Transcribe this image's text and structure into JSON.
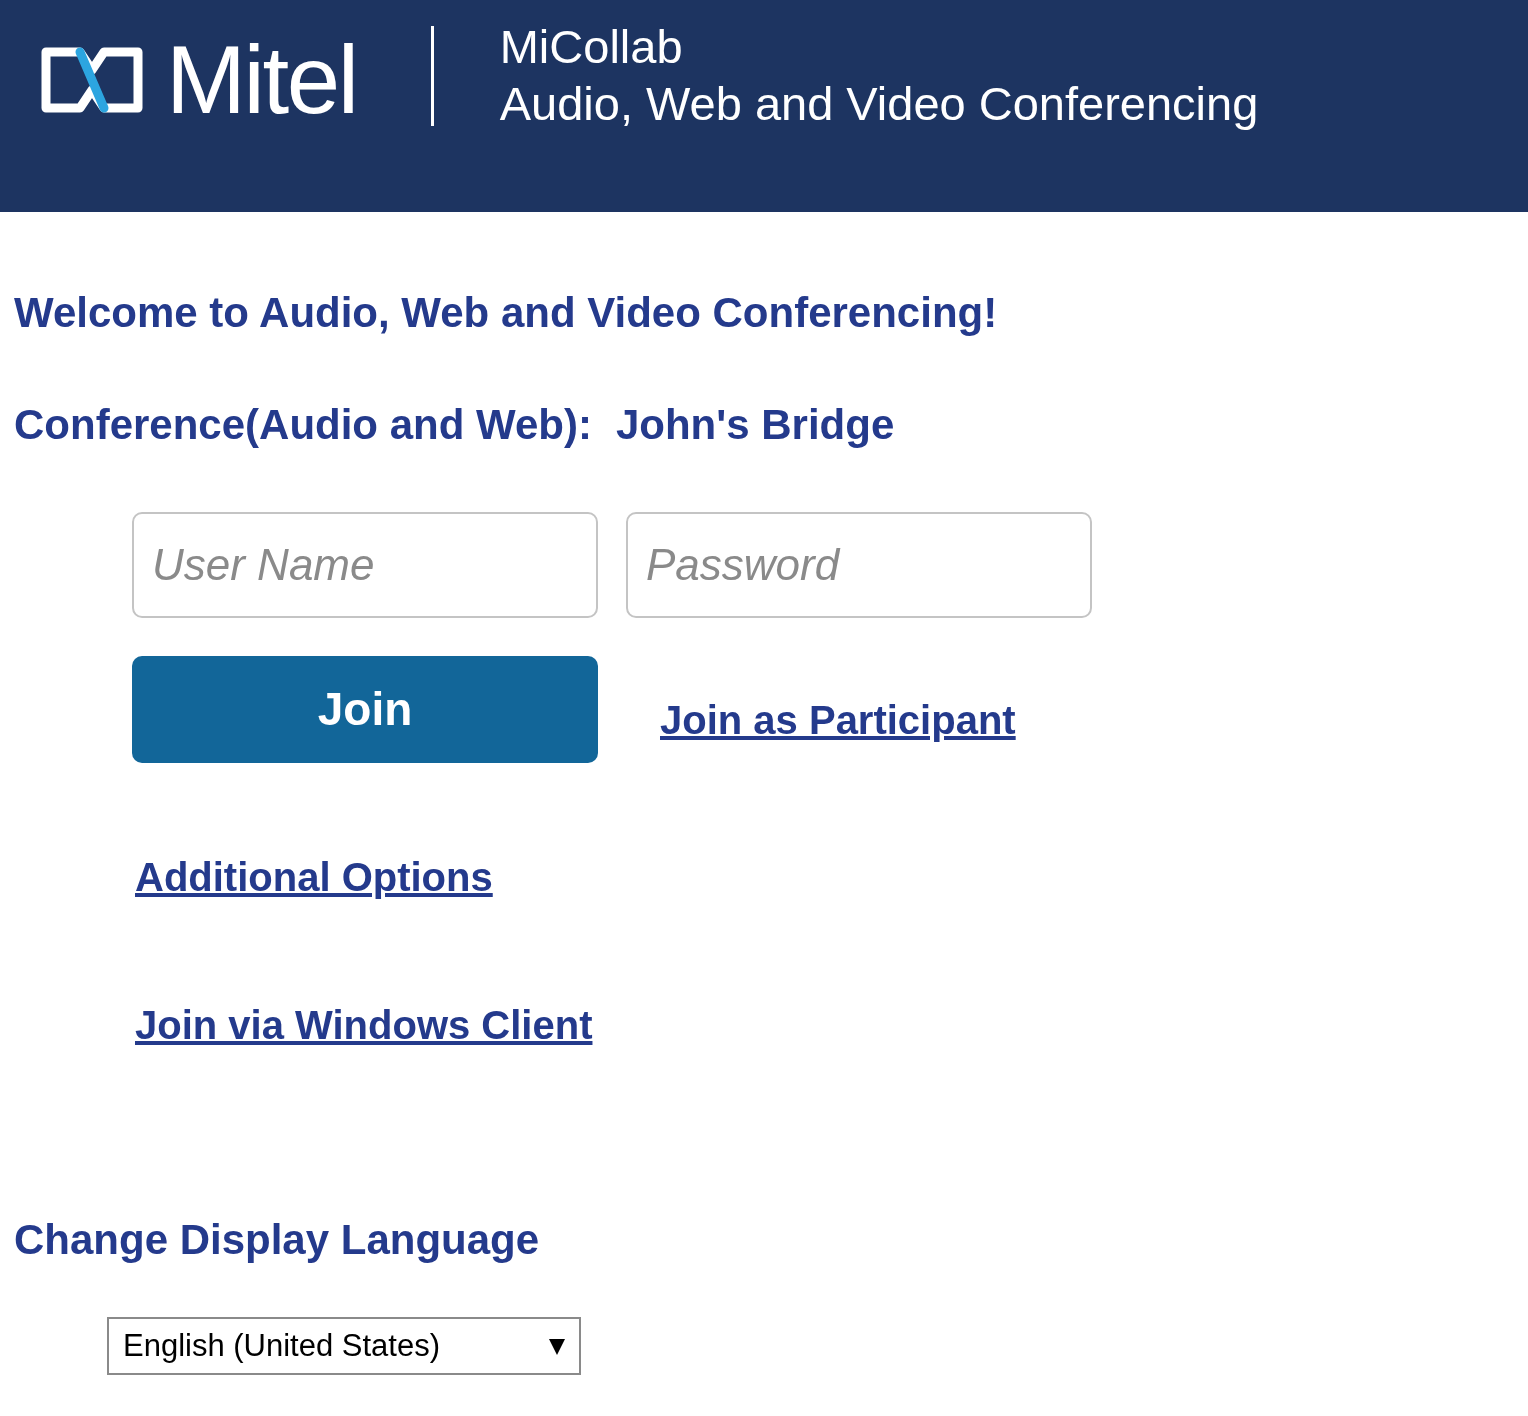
{
  "header": {
    "brand": "Mitel",
    "product": "MiCollab",
    "subtitle": "Audio, Web and Video Conferencing"
  },
  "welcome": "Welcome to Audio, Web and Video Conferencing!",
  "conference": {
    "label": "Conference(Audio and Web):",
    "name": "John's Bridge"
  },
  "login": {
    "username": {
      "placeholder": "User Name"
    },
    "password": {
      "placeholder": "Password"
    },
    "join_button": "Join",
    "participant_link": "Join as Participant"
  },
  "links": [
    "Additional Options",
    "Join via Windows Client"
  ],
  "language": {
    "heading": "Change Display Language",
    "value": "English (United States)"
  }
}
